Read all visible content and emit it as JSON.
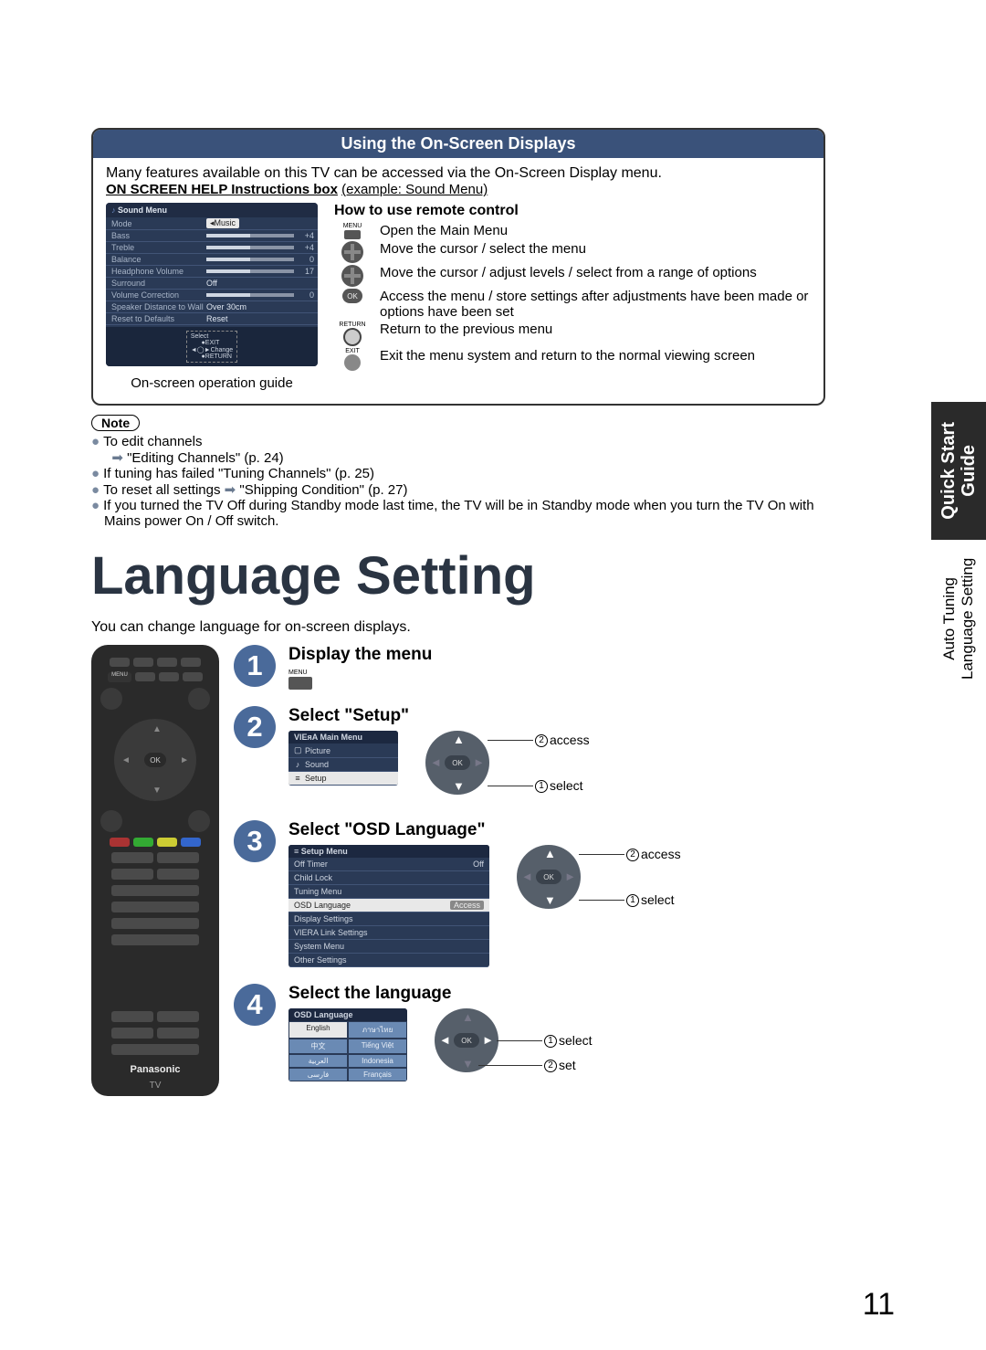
{
  "panel": {
    "title": "Using the On-Screen Displays",
    "intro": "Many features available on this TV can be accessed via the On-Screen Display menu.",
    "help_label": "ON SCREEN HELP Instructions box",
    "help_example": "(example: Sound Menu)"
  },
  "sound_menu": {
    "title": "Sound Menu",
    "rows": [
      {
        "label": "Mode",
        "value": "Music",
        "selected": true
      },
      {
        "label": "Bass",
        "value": "+4",
        "slider": true
      },
      {
        "label": "Treble",
        "value": "+4",
        "slider": true
      },
      {
        "label": "Balance",
        "value": "0",
        "slider": true
      },
      {
        "label": "Headphone Volume",
        "value": "17",
        "slider": true
      },
      {
        "label": "Surround",
        "value": "Off"
      },
      {
        "label": "Volume Correction",
        "value": "0",
        "slider": true
      },
      {
        "label": "Speaker Distance to Wall",
        "value": "Over 30cm"
      },
      {
        "label": "Reset to Defaults",
        "value": "Reset"
      }
    ],
    "foot": {
      "select": "Select",
      "exit": "EXIT",
      "change": "Change",
      "ret": "RETURN"
    },
    "guide": "On-screen operation guide"
  },
  "howto": {
    "title": "How to use remote control",
    "items": [
      {
        "key": "MENU",
        "text": "Open the Main Menu"
      },
      {
        "key": "VPAD",
        "text": "Move the cursor / select the menu"
      },
      {
        "key": "HPAD",
        "text": "Move the cursor / adjust levels / select from a range of options"
      },
      {
        "key": "OK",
        "text": "Access the menu / store settings after adjustments have been made or options have been set"
      },
      {
        "key": "RETURN",
        "text": "Return to the previous menu"
      },
      {
        "key": "EXIT",
        "text": "Exit the menu system and return to the normal viewing screen"
      }
    ]
  },
  "note_label": "Note",
  "notes": {
    "n1": "To edit channels",
    "n1s": "\"Editing Channels\" (p. 24)",
    "n2": "If tuning has failed \"Tuning Channels\" (p. 25)",
    "n3a": "To reset all settings ",
    "n3b": " \"Shipping Condition\" (p. 27)",
    "n4": "If you turned the TV Off during Standby mode last time, the TV will be in Standby mode when you turn the TV On with Mains power On / Off switch."
  },
  "title": "Language Setting",
  "lang_intro": "You can change language for on-screen displays.",
  "steps": {
    "s1": {
      "num": "1",
      "title": "Display the menu",
      "menu_label": "MENU"
    },
    "s2": {
      "num": "2",
      "title": "Select \"Setup\""
    },
    "s3": {
      "num": "3",
      "title": "Select \"OSD Language\""
    },
    "s4": {
      "num": "4",
      "title": "Select the language"
    }
  },
  "main_menu": {
    "title": "Main Menu",
    "brand": "VIEᴙA",
    "items": [
      "Picture",
      "Sound",
      "Setup"
    ],
    "sel": 2
  },
  "setup_menu": {
    "title": "Setup Menu",
    "items": [
      {
        "label": "Off Timer",
        "val": "Off"
      },
      {
        "label": "Child Lock",
        "val": ""
      },
      {
        "label": "Tuning Menu",
        "val": ""
      },
      {
        "label": "OSD Language",
        "val": "Access",
        "sel": true
      },
      {
        "label": "Display Settings",
        "val": ""
      },
      {
        "label": "VIERA Link Settings",
        "val": ""
      },
      {
        "label": "System Menu",
        "val": ""
      },
      {
        "label": "Other Settings",
        "val": ""
      }
    ]
  },
  "osd_lang": {
    "title": "OSD Language",
    "options": [
      [
        "English",
        "ภาษาไทย"
      ],
      [
        "中文",
        "Tiếng Việt"
      ],
      [
        "العربية",
        "Indonesia"
      ],
      [
        "فارسی",
        "Français"
      ]
    ],
    "sel_r": 0,
    "sel_c": 0
  },
  "dpad_labels": {
    "access": "access",
    "select": "select",
    "set": "set",
    "ok": "OK"
  },
  "remote": {
    "brand": "Panasonic",
    "tv": "TV",
    "ok": "OK",
    "menu": "MENU"
  },
  "side": {
    "quick": "Quick Start",
    "guide": "Guide",
    "l1": "Auto Tuning",
    "l2": "Language Setting"
  },
  "page_no": "11"
}
